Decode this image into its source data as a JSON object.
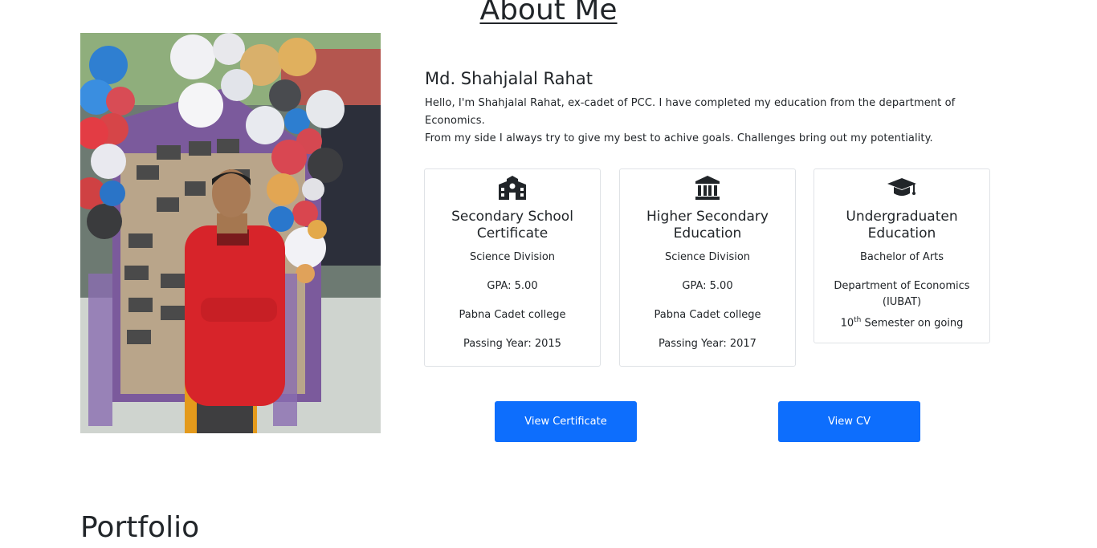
{
  "about": {
    "heading": "About Me",
    "name": "Md. Shahjalal Rahat",
    "bio_line1": "Hello, I'm Shahjalal Rahat, ex-cadet of PCC. I have completed my education from the department of Economics.",
    "bio_line2": "From my side I always try to give my best to achive goals. Challenges bring out my potentiality."
  },
  "education": [
    {
      "icon": "school-icon",
      "title": "Secondary School Certificate",
      "division": "Science Division",
      "gpa": "GPA: 5.00",
      "institution": "Pabna Cadet college",
      "year": "Passing Year: 2015"
    },
    {
      "icon": "institution-icon",
      "title": "Higher Secondary Education",
      "division": "Science Division",
      "gpa": "GPA: 5.00",
      "institution": "Pabna Cadet college",
      "year": "Passing Year: 2017"
    },
    {
      "icon": "graduation-cap-icon",
      "title": "Undergraduaten Education",
      "degree": "Bachelor of Arts",
      "department": "Department of Economics (IUBAT)",
      "semester_num": "10",
      "semester_sup": "th",
      "semester_text": " Semester on going"
    }
  ],
  "buttons": {
    "certificate": "View Certificate",
    "cv": "View CV",
    "color": "#0d6efd"
  },
  "next_section": {
    "heading": "Portfolio"
  }
}
